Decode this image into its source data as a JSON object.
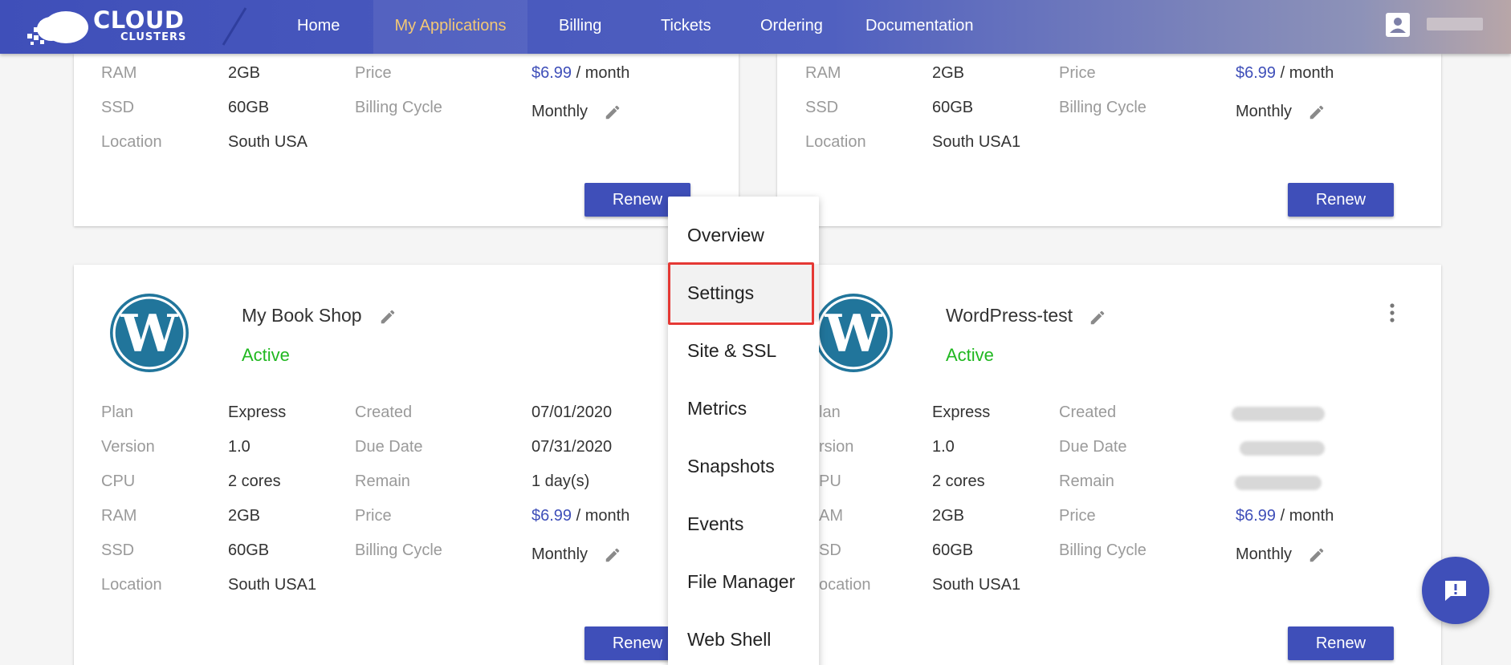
{
  "brand": {
    "line1": "CLOUD",
    "line2": "CLUSTERS"
  },
  "nav": {
    "items": [
      {
        "label": "Home"
      },
      {
        "label": "My Applications",
        "active": true
      },
      {
        "label": "Billing"
      },
      {
        "label": "Tickets"
      },
      {
        "label": "Ordering"
      },
      {
        "label": "Documentation"
      }
    ]
  },
  "labels": {
    "plan": "Plan",
    "version": "Version",
    "cpu": "CPU",
    "ram": "RAM",
    "ssd": "SSD",
    "location": "Location",
    "created": "Created",
    "due_date": "Due Date",
    "remain": "Remain",
    "price": "Price",
    "billing_cycle": "Billing Cycle",
    "per_month": "/ month",
    "renew": "Renew"
  },
  "cards_top": [
    {
      "ram": "2GB",
      "ssd": "60GB",
      "location": "South USA",
      "price": "$6.99",
      "billing_cycle": "Monthly"
    },
    {
      "ram": "2GB",
      "ssd": "60GB",
      "location": "South USA1",
      "price": "$6.99",
      "billing_cycle": "Monthly"
    }
  ],
  "cards_bottom": [
    {
      "name": "My Book Shop",
      "status": "Active",
      "plan": "Express",
      "version": "1.0",
      "cpu": "2 cores",
      "ram": "2GB",
      "ssd": "60GB",
      "location": "South USA1",
      "created": "07/01/2020",
      "due_date": "07/31/2020",
      "remain": "1 day(s)",
      "price": "$6.99",
      "billing_cycle": "Monthly"
    },
    {
      "name": "WordPress-test",
      "status": "Active",
      "plan_label_partial": "lan",
      "version_label_partial": "rsion",
      "cpu_label_partial": "PU",
      "ram_label_partial": "AM",
      "ssd_label_partial": "SD",
      "location_label_partial": "ocation",
      "plan": "Express",
      "version": "1.0",
      "cpu": "2 cores",
      "ram": "2GB",
      "ssd": "60GB",
      "location": "South USA1",
      "price": "$6.99",
      "billing_cycle": "Monthly"
    }
  ],
  "menu": {
    "items": [
      {
        "label": "Overview"
      },
      {
        "label": "Settings",
        "highlighted": true
      },
      {
        "label": "Site & SSL"
      },
      {
        "label": "Metrics"
      },
      {
        "label": "Snapshots"
      },
      {
        "label": "Events"
      },
      {
        "label": "File Manager"
      },
      {
        "label": "Web Shell"
      }
    ]
  },
  "colors": {
    "primary": "#3f4fb9",
    "active_nav": "#f3c875",
    "status_active": "#21b821",
    "highlight": "#e53935",
    "wordpress_blue": "#21759b"
  },
  "icons": {
    "user": "user-account-icon",
    "edit": "pencil-icon",
    "more": "kebab-menu-icon",
    "chat": "chat-alert-icon",
    "app": "wordpress-logo-icon"
  }
}
